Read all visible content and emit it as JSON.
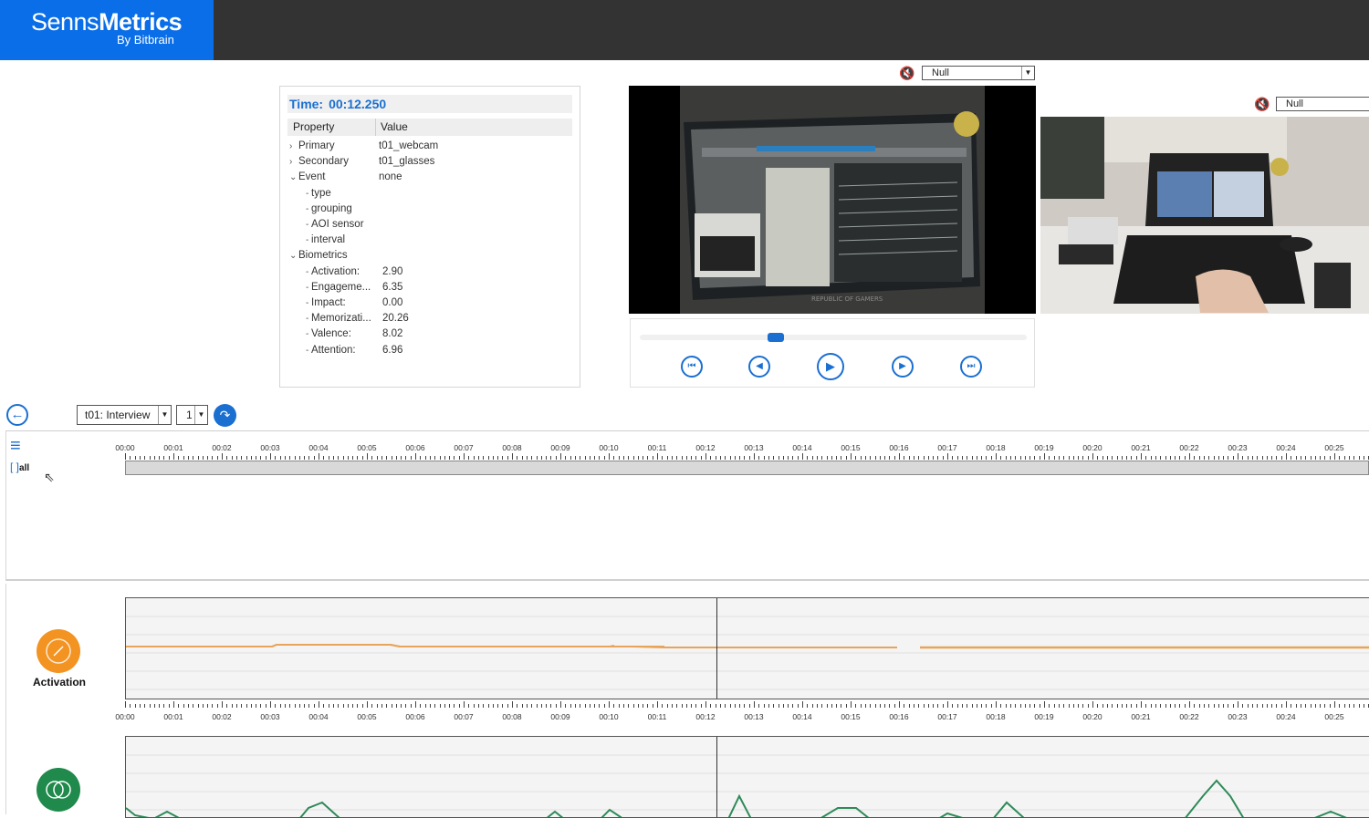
{
  "header": {
    "brand_light": "Senns",
    "brand_bold": "Metrics",
    "by_line": "By Bitbrain",
    "colors": {
      "logo_bg": "#0a6ee8",
      "bar_bg": "#333333"
    }
  },
  "properties": {
    "time_label": "Time:",
    "time_value": "00:12.250",
    "col_property": "Property",
    "col_value": "Value",
    "rows": [
      {
        "key": "Primary",
        "value": "t01_webcam",
        "arrow": "›",
        "indent": 0
      },
      {
        "key": "Secondary",
        "value": "t01_glasses",
        "arrow": "›",
        "indent": 0
      },
      {
        "key": "Event",
        "value": "none",
        "arrow": "⌄",
        "indent": 0
      },
      {
        "key": "type",
        "value": "",
        "arrow": "",
        "indent": 1
      },
      {
        "key": "grouping",
        "value": "",
        "arrow": "",
        "indent": 1
      },
      {
        "key": "AOI sensor",
        "value": "",
        "arrow": "",
        "indent": 1
      },
      {
        "key": "interval",
        "value": "",
        "arrow": "",
        "indent": 1
      },
      {
        "key": "Biometrics",
        "value": "",
        "arrow": "⌄",
        "indent": 0
      },
      {
        "key": "Activation:",
        "value": "2.90",
        "arrow": "",
        "indent": 1
      },
      {
        "key": "Engageme...",
        "value": "6.35",
        "arrow": "",
        "indent": 1
      },
      {
        "key": "Impact:",
        "value": "0.00",
        "arrow": "",
        "indent": 1
      },
      {
        "key": "Memorizati...",
        "value": "20.26",
        "arrow": "",
        "indent": 1
      },
      {
        "key": "Valence:",
        "value": "8.02",
        "arrow": "",
        "indent": 1
      },
      {
        "key": "Attention:",
        "value": "6.96",
        "arrow": "",
        "indent": 1
      }
    ]
  },
  "video": {
    "main_source": "Null",
    "second_source": "Null",
    "seek_position": 0.33
  },
  "toolbar": {
    "session": "t01: Interview",
    "number": "1"
  },
  "timeline": {
    "all_label": "all",
    "ticks": [
      "00:00",
      "00:01",
      "00:02",
      "00:03",
      "00:04",
      "00:05",
      "00:06",
      "00:07",
      "00:08",
      "00:09",
      "00:10",
      "00:11",
      "00:12",
      "00:13",
      "00:14",
      "00:15",
      "00:16",
      "00:17",
      "00:18",
      "00:19",
      "00:20",
      "00:21",
      "00:22",
      "00:23",
      "00:24",
      "00:25"
    ],
    "playhead_seconds": 12.25
  },
  "metrics": {
    "activation_label": "Activation",
    "activation_color": "#f39322",
    "second_color": "#1f8a4c",
    "line_colors": {
      "activation": "#e8a45a",
      "second": "#2e8a58"
    }
  }
}
